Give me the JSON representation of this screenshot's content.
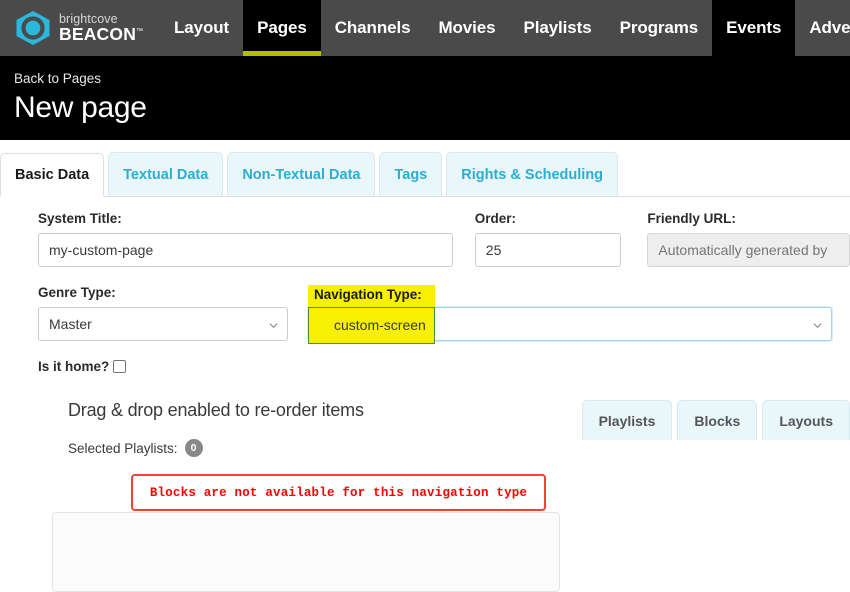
{
  "brand": {
    "top_word": "brightcove",
    "bottom_word": "BEACON",
    "trademark": "™",
    "logo_icon": "hexagon-circle-logo-icon",
    "accent_color": "#2ab8dc"
  },
  "topnav": {
    "background_color": "#4a4a4a",
    "active_underline_color": "#b4bd00",
    "items": [
      {
        "label": "Layout",
        "state": "default"
      },
      {
        "label": "Pages",
        "state": "active"
      },
      {
        "label": "Channels",
        "state": "default"
      },
      {
        "label": "Movies",
        "state": "default"
      },
      {
        "label": "Playlists",
        "state": "default"
      },
      {
        "label": "Programs",
        "state": "default"
      },
      {
        "label": "Events",
        "state": "hover"
      },
      {
        "label": "Advertisement",
        "state": "default"
      }
    ]
  },
  "page_header": {
    "back_link": "Back to Pages",
    "title": "New page"
  },
  "detail_tabs": {
    "active_index": 0,
    "items": [
      {
        "label": "Basic Data"
      },
      {
        "label": "Textual Data"
      },
      {
        "label": "Non-Textual Data"
      },
      {
        "label": "Tags"
      },
      {
        "label": "Rights & Scheduling"
      }
    ]
  },
  "form": {
    "system_title": {
      "label": "System Title:",
      "value": "my-custom-page"
    },
    "order": {
      "label": "Order:",
      "value": "25"
    },
    "friendly_url": {
      "label": "Friendly URL:",
      "placeholder": "Automatically generated by",
      "disabled": true
    },
    "genre_type": {
      "label": "Genre Type:",
      "value": "Master",
      "caret_icon": "chevron-down-icon"
    },
    "navigation_type": {
      "label": "Navigation Type:",
      "value": "custom-screen",
      "caret_icon": "chevron-down-icon",
      "focused": true,
      "highlight_color": "#f7f000"
    },
    "is_home": {
      "label": "Is it home?",
      "checked": false
    }
  },
  "lower": {
    "drag_title": "Drag & drop enabled to re-order items",
    "selected_playlists": {
      "label": "Selected Playlists:",
      "count": "0"
    },
    "side_tabs": [
      {
        "label": "Playlists"
      },
      {
        "label": "Blocks"
      },
      {
        "label": "Layouts"
      }
    ],
    "error": {
      "message": "Blocks are not available for this navigation type",
      "border_color": "#f44336",
      "text_color": "#ff0000"
    }
  }
}
